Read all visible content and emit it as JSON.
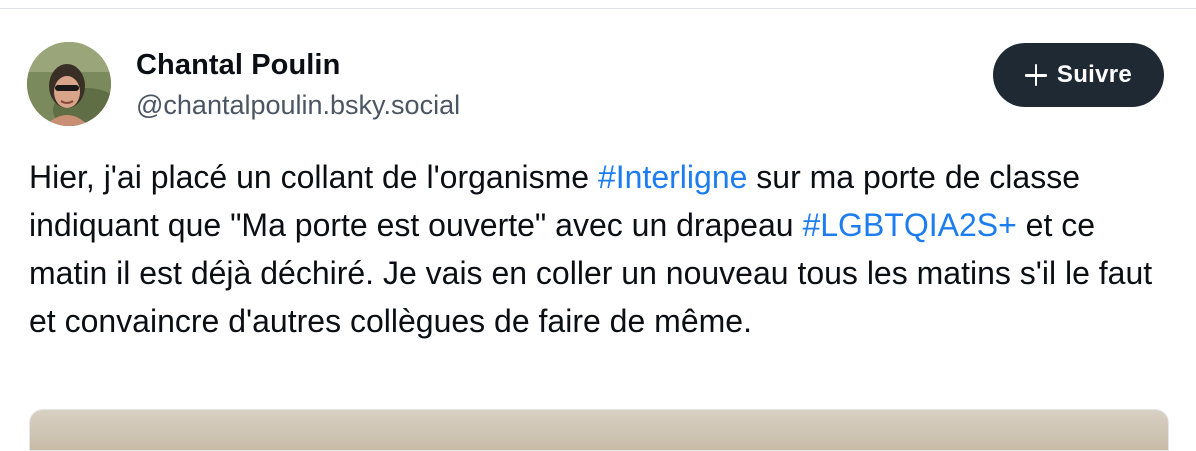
{
  "post": {
    "author": {
      "display_name": "Chantal Poulin",
      "handle": "@chantalpoulin.bsky.social",
      "avatar_icon": "user-photo"
    },
    "follow_button": {
      "icon": "plus-icon",
      "label": "Suivre"
    },
    "text_parts": [
      "Hier, j'ai placé un collant de l'organisme ",
      "#Interligne",
      " sur ma porte de classe indiquant que \"Ma porte est ouverte\" avec un drapeau ",
      "#LGBTQIA2S+",
      " et ce matin il est déjà déchiré. Je vais en coller un nouveau tous les matins s'il le faut et convaincre d'autres collègues de faire de même."
    ]
  },
  "colors": {
    "hashtag": "#1d7df0",
    "follow_button_bg": "#1e2934",
    "text": "#0b0f14",
    "handle": "#4b5563"
  }
}
